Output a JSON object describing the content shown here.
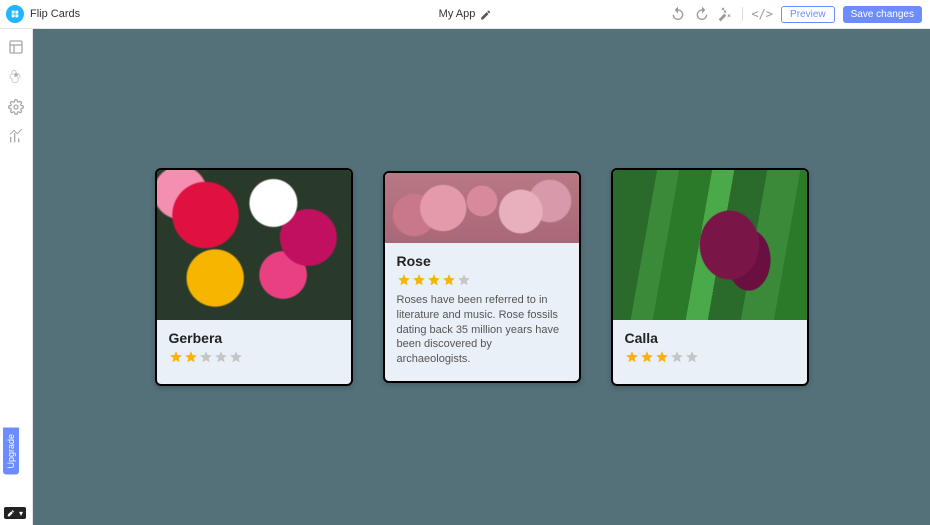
{
  "header": {
    "page_label": "Flip Cards",
    "app_name": "My App",
    "preview_label": "Preview",
    "save_label": "Save changes"
  },
  "sidebar": {
    "upgrade_label": "Upgrade"
  },
  "cards": [
    {
      "title": "Gerbera",
      "rating": 2,
      "max_rating": 5,
      "description": ""
    },
    {
      "title": "Rose",
      "rating": 4,
      "max_rating": 5,
      "description": "Roses have been referred to in literature and music. Rose fossils dating back 35 million years have been discovered by archaeologists."
    },
    {
      "title": "Calla",
      "rating": 3,
      "max_rating": 5,
      "description": ""
    }
  ]
}
